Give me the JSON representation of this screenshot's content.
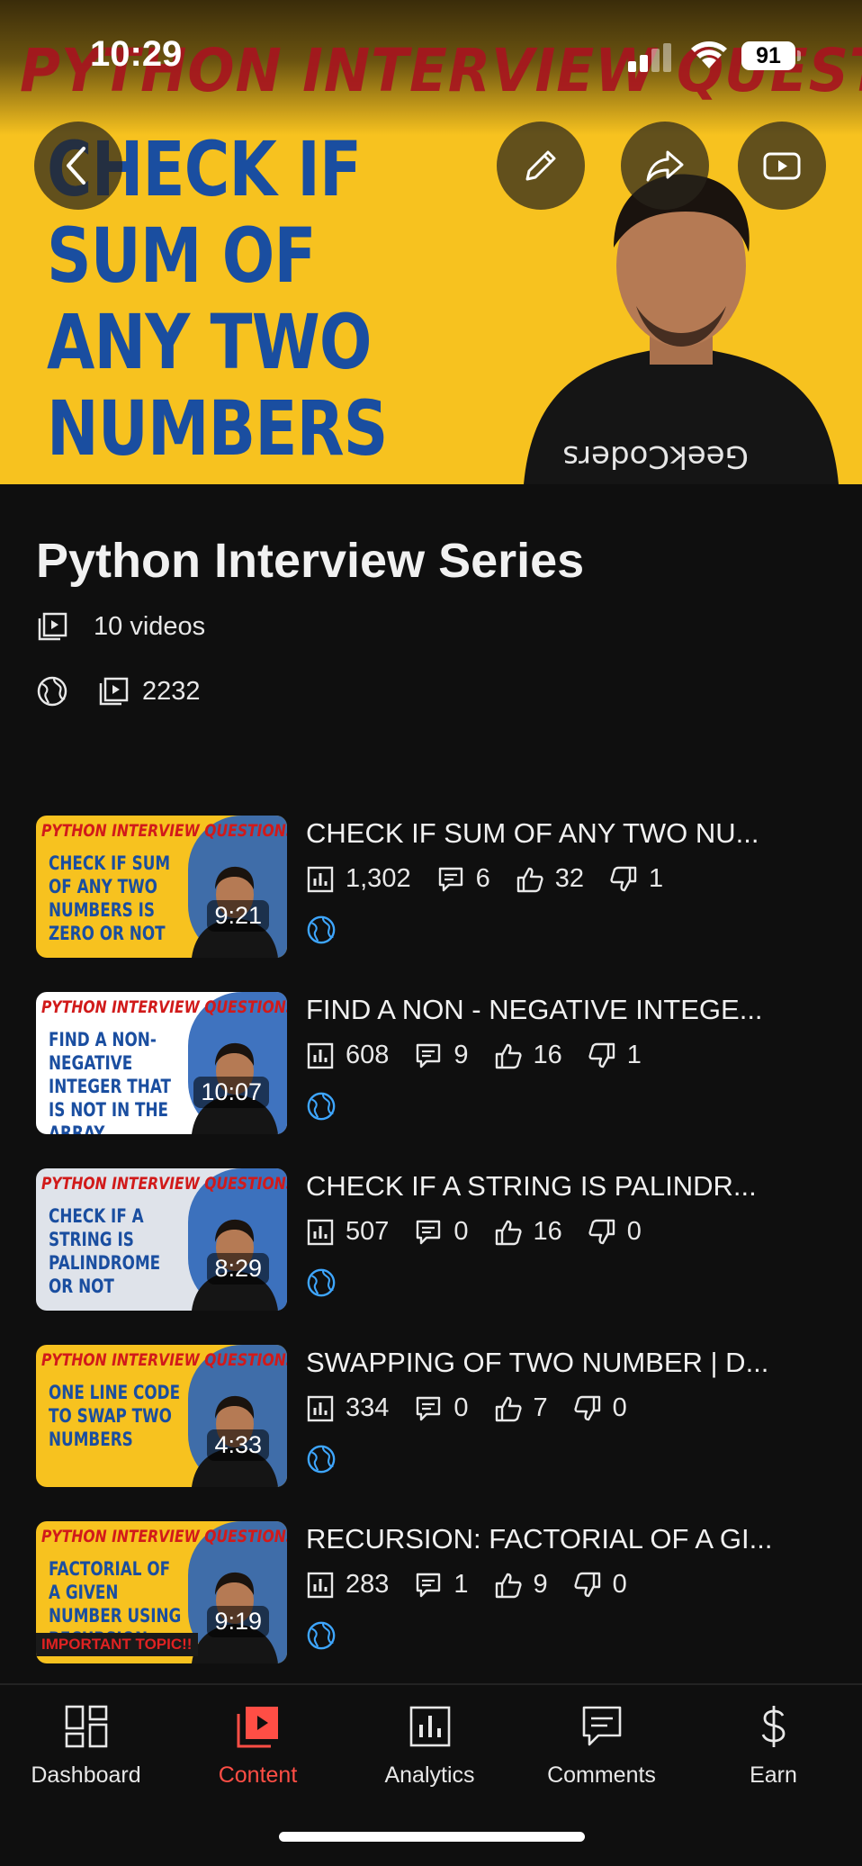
{
  "status_bar": {
    "time": "10:29",
    "battery": "91"
  },
  "hero": {
    "banner": "PYTHON INTERVIEW QUESTIONS",
    "title": "CHECK IF SUM OF ANY TWO NUMBERS IS ZERO OR NOT",
    "shirt_text": "GeekCoders"
  },
  "playlist": {
    "title": "Python Interview Series",
    "video_count": "10 videos",
    "views": "2232"
  },
  "videos": [
    {
      "title": "CHECK IF SUM OF ANY TWO NU...",
      "views": "1,302",
      "comments": "6",
      "likes": "32",
      "dislikes": "1",
      "duration": "9:21",
      "thumb_banner": "PYTHON INTERVIEW QUESTIONS",
      "thumb_text": "CHECK IF SUM OF ANY TWO NUMBERS IS ZERO OR NOT",
      "thumb_bg": "#f7c21f"
    },
    {
      "title": "FIND A NON - NEGATIVE INTEGE...",
      "views": "608",
      "comments": "9",
      "likes": "16",
      "dislikes": "1",
      "duration": "10:07",
      "thumb_banner": "PYTHON INTERVIEW QUESTIONS",
      "thumb_text": "FIND A NON-NEGATIVE INTEGER THAT IS NOT IN THE ARRAY",
      "thumb_bg": "#ffffff"
    },
    {
      "title": "CHECK IF A STRING IS PALINDR...",
      "views": "507",
      "comments": "0",
      "likes": "16",
      "dislikes": "0",
      "duration": "8:29",
      "thumb_banner": "PYTHON INTERVIEW QUESTIONS",
      "thumb_text": "CHECK IF A STRING IS PALINDROME OR NOT",
      "thumb_bg": "#dfe3ea"
    },
    {
      "title": "SWAPPING OF TWO NUMBER | D...",
      "views": "334",
      "comments": "0",
      "likes": "7",
      "dislikes": "0",
      "duration": "4:33",
      "thumb_banner": "PYTHON INTERVIEW QUESTIONS",
      "thumb_text": "ONE LINE CODE TO SWAP TWO NUMBERS",
      "thumb_bg": "#f7c21f"
    },
    {
      "title": "RECURSION: FACTORIAL OF A GI...",
      "views": "283",
      "comments": "1",
      "likes": "9",
      "dislikes": "0",
      "duration": "9:19",
      "thumb_banner": "PYTHON INTERVIEW QUESTIONS",
      "thumb_text": "FACTORIAL OF A GIVEN NUMBER USING RECURSION",
      "thumb_bg": "#f7c21f",
      "thumb_badge": "IMPORTANT TOPIC!!"
    }
  ],
  "bottom_nav": [
    {
      "label": "Dashboard",
      "icon": "dashboard-icon"
    },
    {
      "label": "Content",
      "icon": "content-icon",
      "active": true
    },
    {
      "label": "Analytics",
      "icon": "analytics-icon"
    },
    {
      "label": "Comments",
      "icon": "comments-icon"
    },
    {
      "label": "Earn",
      "icon": "dollar-icon"
    }
  ],
  "colors": {
    "background": "#0f0f0f",
    "accent": "#ff4e45",
    "globe": "#3ea6ff",
    "thumb_yellow": "#f7c21f",
    "thumb_blue": "#1a4ea0"
  }
}
